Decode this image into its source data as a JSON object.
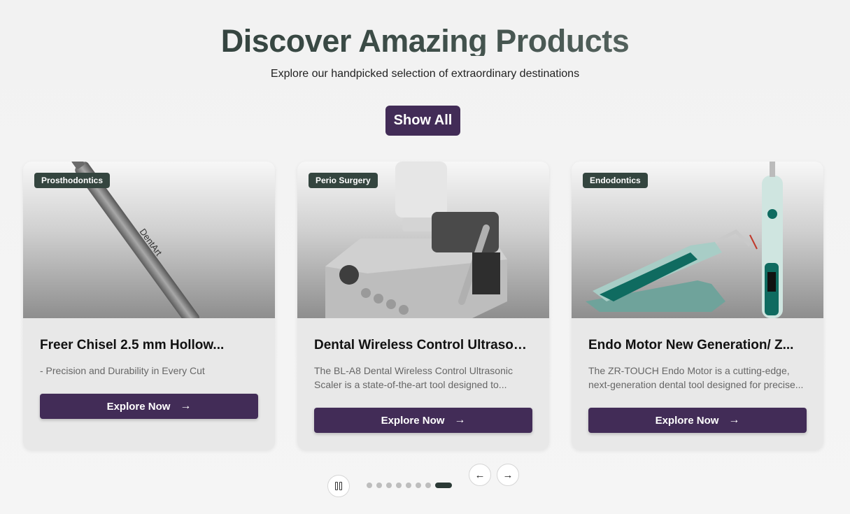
{
  "header": {
    "title": "Discover Amazing Products",
    "subtitle": "Explore our handpicked selection of extraordinary destinations",
    "show_all_label": "Show All"
  },
  "cards": [
    {
      "category": "Prosthodontics",
      "title": "Freer Chisel 2.5 mm Hollow...",
      "description": "- Precision and Durability in Every Cut",
      "button_label": "Explore Now",
      "image_text": "DentArt"
    },
    {
      "category": "Perio Surgery",
      "title": "Dental Wireless Control Ultrason...",
      "description": "The BL-A8 Dental Wireless Control Ultrasonic Scaler is a state-of-the-art tool designed to...",
      "button_label": "Explore Now"
    },
    {
      "category": "Endodontics",
      "title": "Endo Motor New Generation/ Z...",
      "description": "The ZR-TOUCH Endo Motor is a cutting-edge, next-generation dental tool designed for precise...",
      "button_label": "Explore Now"
    }
  ],
  "carousel": {
    "dot_count": 8,
    "active_dot": 8,
    "prev_icon": "arrow-left-icon",
    "next_icon": "arrow-right-icon",
    "pause_icon": "pause-icon"
  },
  "colors": {
    "accent": "#422c57",
    "badge": "#34453f",
    "active_dot": "#2b3a36"
  }
}
